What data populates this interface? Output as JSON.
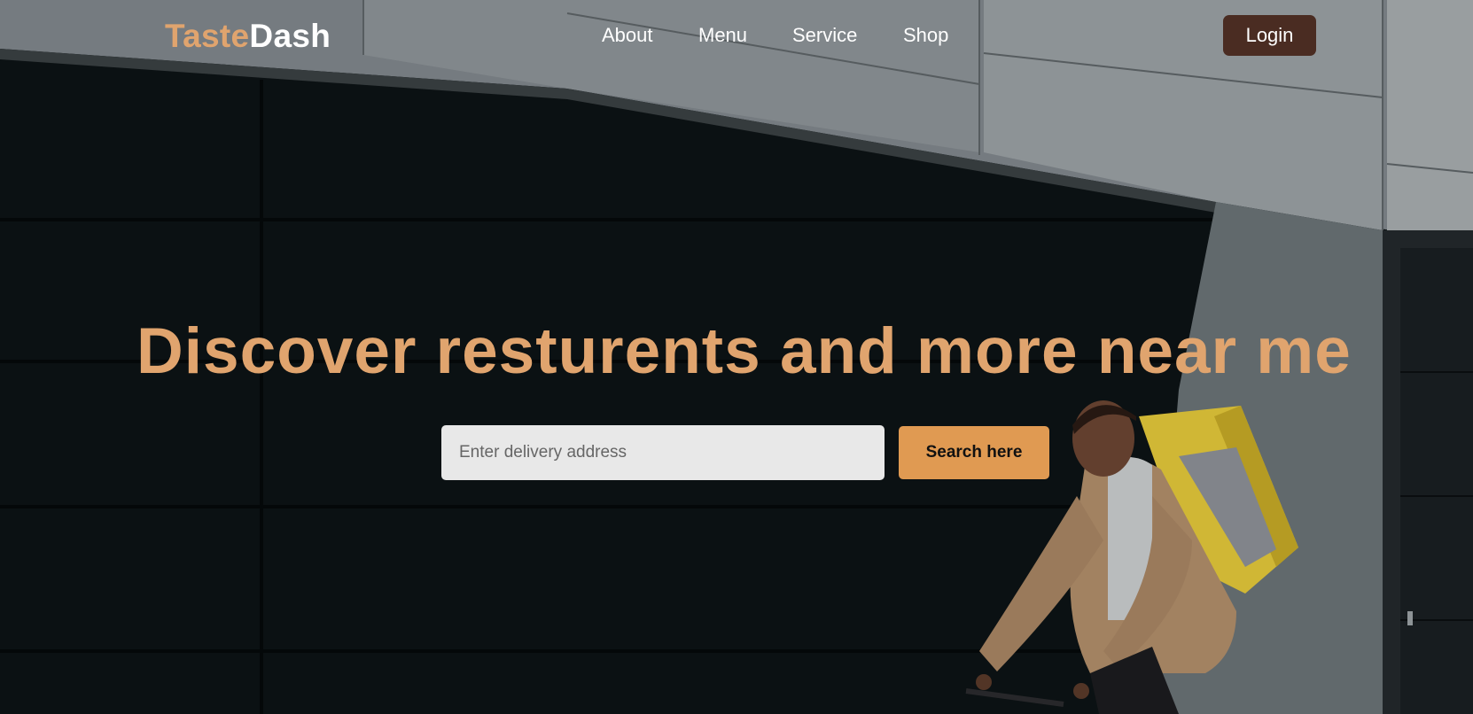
{
  "brand": {
    "part1": "Taste",
    "part2": "Dash"
  },
  "nav": {
    "links": [
      "About",
      "Menu",
      "Service",
      "Shop"
    ],
    "login_label": "Login"
  },
  "hero": {
    "headline": "Discover resturents and more near me",
    "search_placeholder": "Enter delivery address",
    "search_button_label": "Search here"
  },
  "colors": {
    "accent": "#e0a46e",
    "button_orange": "#e09a52",
    "login_bg": "#4a2c22"
  }
}
